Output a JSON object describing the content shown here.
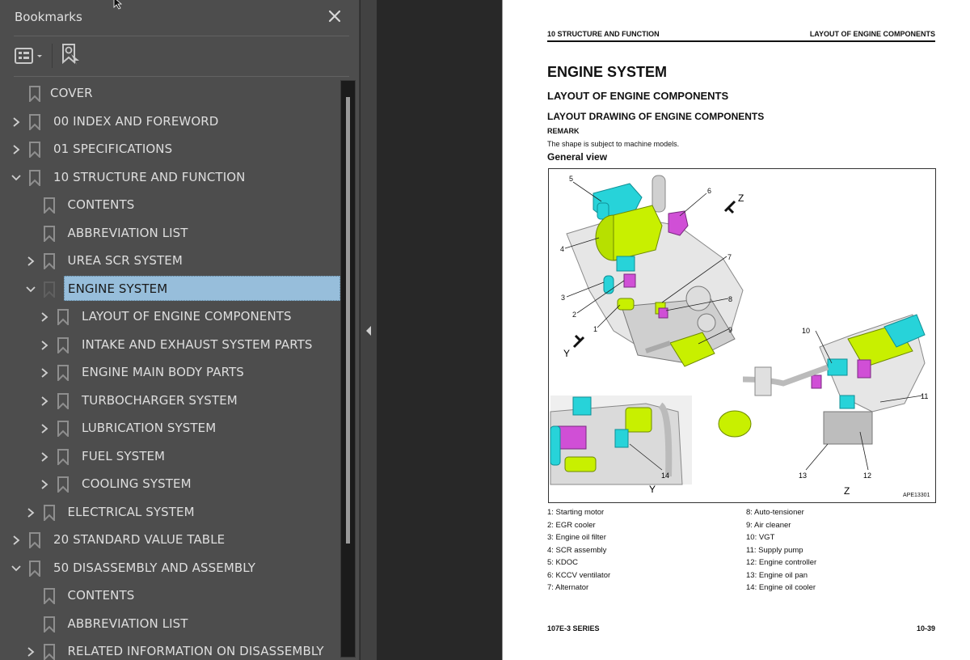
{
  "sidebar": {
    "title": "Bookmarks",
    "close_icon": "close-icon",
    "toolbar": {
      "options_icon": "list-options-icon",
      "find_icon": "find-current-bookmark-icon"
    },
    "items": [
      {
        "label": "COVER",
        "level": 0,
        "expander": "none"
      },
      {
        "label": "00 INDEX AND FOREWORD",
        "level": 0,
        "expander": "collapsed"
      },
      {
        "label": "01 SPECIFICATIONS",
        "level": 0,
        "expander": "collapsed"
      },
      {
        "label": "10 STRUCTURE AND FUNCTION",
        "level": 0,
        "expander": "expanded"
      },
      {
        "label": "CONTENTS",
        "level": 1,
        "expander": "none"
      },
      {
        "label": "ABBREVIATION LIST",
        "level": 1,
        "expander": "none"
      },
      {
        "label": "UREA SCR SYSTEM",
        "level": 1,
        "expander": "collapsed"
      },
      {
        "label": "ENGINE SYSTEM",
        "level": 1,
        "expander": "expanded",
        "selected": true
      },
      {
        "label": "LAYOUT OF ENGINE COMPONENTS",
        "level": 2,
        "expander": "collapsed"
      },
      {
        "label": "INTAKE AND EXHAUST SYSTEM PARTS",
        "level": 2,
        "expander": "collapsed"
      },
      {
        "label": "ENGINE MAIN BODY PARTS",
        "level": 2,
        "expander": "collapsed"
      },
      {
        "label": "TURBOCHARGER SYSTEM",
        "level": 2,
        "expander": "collapsed"
      },
      {
        "label": "LUBRICATION SYSTEM",
        "level": 2,
        "expander": "collapsed"
      },
      {
        "label": "FUEL SYSTEM",
        "level": 2,
        "expander": "collapsed"
      },
      {
        "label": "COOLING SYSTEM",
        "level": 2,
        "expander": "collapsed"
      },
      {
        "label": "ELECTRICAL SYSTEM",
        "level": 1,
        "expander": "collapsed"
      },
      {
        "label": "20 STANDARD VALUE TABLE",
        "level": 0,
        "expander": "collapsed"
      },
      {
        "label": "50 DISASSEMBLY AND ASSEMBLY",
        "level": 0,
        "expander": "expanded"
      },
      {
        "label": "CONTENTS",
        "level": 1,
        "expander": "none"
      },
      {
        "label": "ABBREVIATION LIST",
        "level": 1,
        "expander": "none"
      },
      {
        "label": "RELATED INFORMATION ON DISASSEMBLY",
        "level": 1,
        "expander": "collapsed"
      }
    ],
    "selection_color": "#97bedb"
  },
  "splitter": {
    "collapse_icon": "collapse-left-icon"
  },
  "page": {
    "header_left": "10 STRUCTURE AND FUNCTION",
    "header_right": "LAYOUT OF ENGINE COMPONENTS",
    "title": "ENGINE SYSTEM",
    "subtitle": "LAYOUT OF ENGINE COMPONENTS",
    "section": "LAYOUT DRAWING OF ENGINE COMPONENTS",
    "remark_label": "REMARK",
    "remark_text": "The shape is subject to machine models.",
    "view_label": "General view",
    "figure": {
      "id": "APE13301",
      "view_labels": {
        "y": "Y",
        "z": "Z"
      },
      "callouts": [
        "1",
        "2",
        "3",
        "4",
        "5",
        "6",
        "7",
        "8",
        "9",
        "10",
        "11",
        "12",
        "13",
        "14"
      ],
      "colors": {
        "scr": "#c8f000",
        "kdoc": "#27d3d9",
        "kccv": "#d04fd6",
        "body": "#d8d8d8"
      }
    },
    "legend_left": [
      "1: Starting motor",
      "2: EGR cooler",
      "3: Engine oil filter",
      "4: SCR assembly",
      "5: KDOC",
      "6: KCCV ventilator",
      "7: Alternator"
    ],
    "legend_right": [
      "8: Auto-tensioner",
      "9: Air cleaner",
      "10: VGT",
      "11: Supply pump",
      "12: Engine controller",
      "13: Engine oil pan",
      "14: Engine oil cooler"
    ],
    "footer_left": "107E-3 SERIES",
    "footer_right": "10-39"
  }
}
